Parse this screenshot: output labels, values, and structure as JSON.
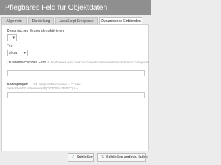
{
  "window": {
    "title": "Pflegbares Feld für Objektdaten"
  },
  "tabs": [
    {
      "label": "Allgemein",
      "active": false
    },
    {
      "label": "Darstellung",
      "active": false
    },
    {
      "label": "JavaScript-Ereignisse",
      "active": false
    },
    {
      "label": "Dynamisches Einblenden",
      "active": true
    }
  ],
  "form": {
    "dynamic_label": "Dynamisches Einblenden aktivieren",
    "dynamic_value": "",
    "type_label": "Typ",
    "type_value": "show",
    "field_label": "Zu überwachendes Feld",
    "field_hint": "z.B. fieldname1 oder: \\oid::\\documentroot\\externes\\neutmeta\\oid::categories",
    "conditions_label": "Bedingungen",
    "conditions_hint_line1": "z.B. SetpostWatch.value != \"\" oder",
    "conditions_hint_line2": "SetpostWatch.value.indexOf(\"1770051435781\") != -1"
  },
  "footer": {
    "close_label": "Schließen",
    "close_reload_label": "Schließen und neu laden"
  },
  "icons": {
    "close_icon": "check-icon",
    "reload_icon": "reload-icon"
  }
}
